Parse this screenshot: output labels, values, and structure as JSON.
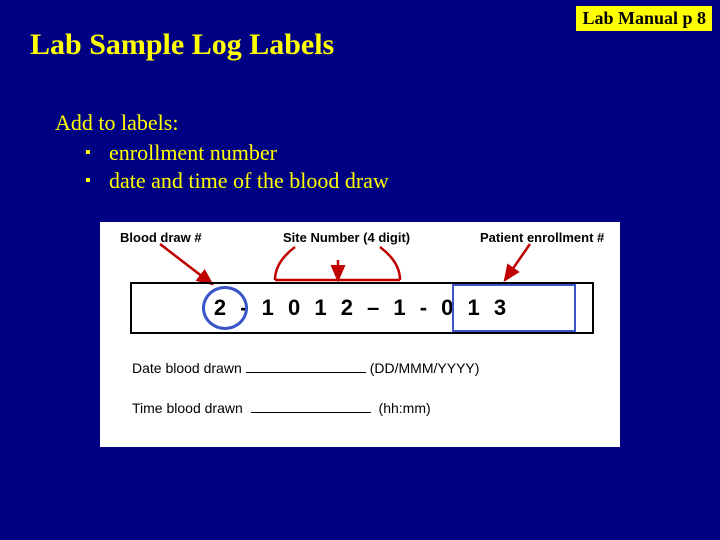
{
  "badge": "Lab Manual p 8",
  "title": "Lab Sample Log Labels",
  "subhead": "Add to labels:",
  "bullets": [
    "enrollment number",
    "date and time of the blood draw"
  ],
  "label": {
    "cap_blood": "Blood draw #",
    "cap_site": "Site Number (4 digit)",
    "cap_enrol": "Patient enrollment #",
    "code": "2 - 1 0 1 2 – 1 - 0 1 3",
    "date_label": "Date blood drawn",
    "date_hint": "(DD/MMM/YYYY)",
    "time_label": "Time blood drawn",
    "time_hint": "(hh:mm)"
  }
}
